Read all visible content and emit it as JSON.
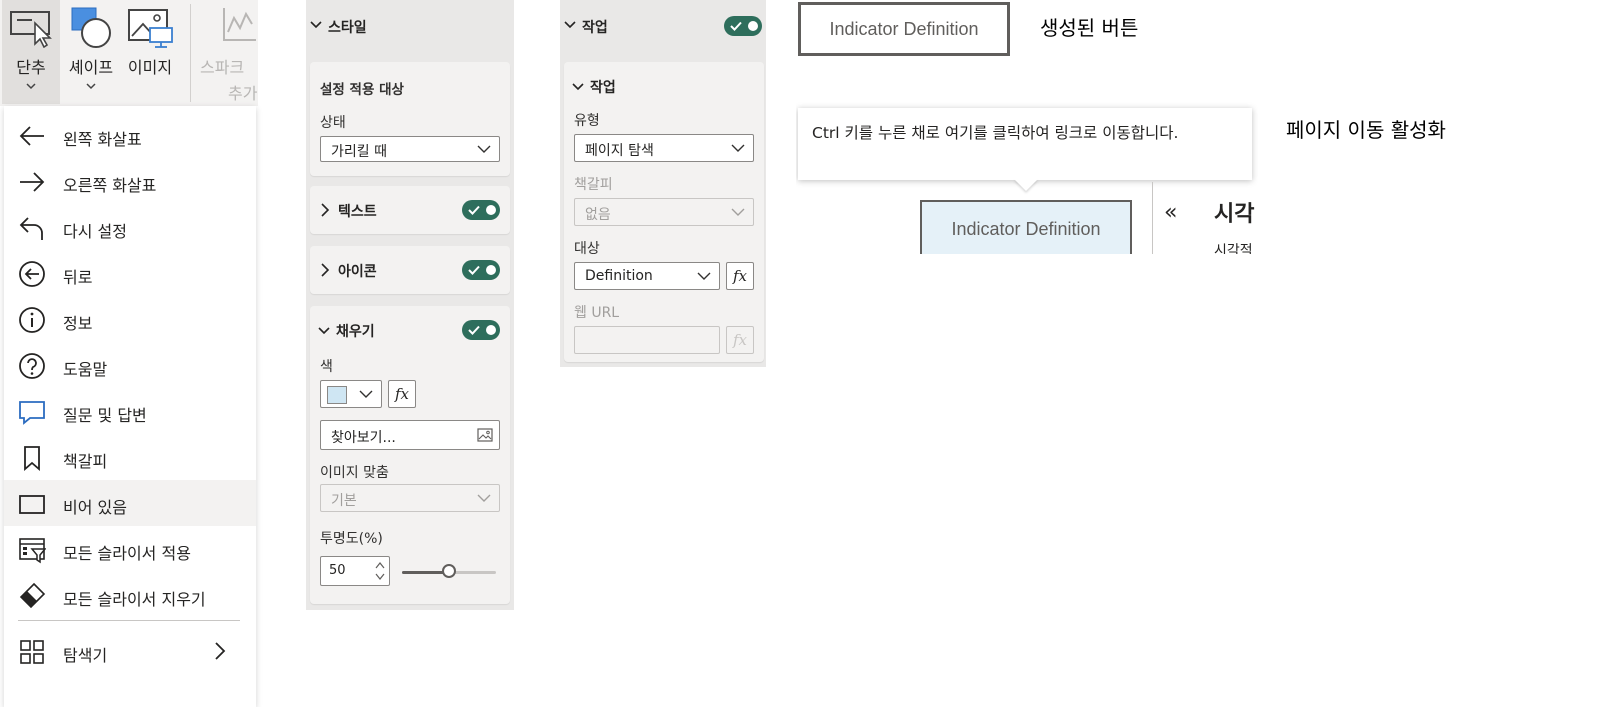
{
  "ribbon": {
    "button_label": "단추",
    "shape_label": "셰이프",
    "image_label": "이미지",
    "sparkline_label": "스파크",
    "sparkline_label2": "추가"
  },
  "menu": {
    "items": [
      {
        "label": "왼쪽 화살표",
        "icon": "arrow-left-icon"
      },
      {
        "label": "오른쪽 화살표",
        "icon": "arrow-right-icon"
      },
      {
        "label": "다시 설정",
        "icon": "reset-icon"
      },
      {
        "label": "뒤로",
        "icon": "back-circle-icon"
      },
      {
        "label": "정보",
        "icon": "info-icon"
      },
      {
        "label": "도움말",
        "icon": "help-icon"
      },
      {
        "label": "질문 및 답변",
        "icon": "qna-icon"
      },
      {
        "label": "책갈피",
        "icon": "bookmark-icon"
      },
      {
        "label": "비어 있음",
        "icon": "blank-icon"
      },
      {
        "label": "모든 슬라이서 적용",
        "icon": "apply-slicers-icon"
      },
      {
        "label": "모든 슬라이서 지우기",
        "icon": "clear-slicers-icon"
      }
    ],
    "navigator_label": "탐색기",
    "highlighted_index": 8
  },
  "style_panel": {
    "header": "스타일",
    "apply_to_label": "설정 적용 대상",
    "state_label": "상태",
    "state_value": "가리킬 때",
    "text_section": "텍스트",
    "icon_section": "아이콘",
    "fill_section": "채우기",
    "color_label": "색",
    "color_value": "#cfe6f3",
    "browse_value": "찾아보기...",
    "image_fit_label": "이미지 맞춤",
    "image_fit_value": "기본",
    "transparency_label": "투명도(%)",
    "transparency_value": "50",
    "transparency_fraction": 0.5
  },
  "action_panel": {
    "header": "작업",
    "section": "작업",
    "type_label": "유형",
    "type_value": "페이지 탐색",
    "bookmark_label": "책갈피",
    "bookmark_value": "없음",
    "destination_label": "대상",
    "destination_value": "Definition",
    "web_url_label": "웹 URL"
  },
  "demo": {
    "button_text": "Indicator Definition",
    "created_caption": "생성된 버튼",
    "tooltip_text": "Ctrl 키를 누른 채로 여기를 클릭하여 링크로 이동합니다.",
    "nav_caption": "페이지 이동 활성화",
    "button_text_2": "Indicator Definition",
    "visual_title": "시각",
    "visual_sub": "시각적"
  },
  "colors": {
    "toggle_on": "#2e6e5c",
    "ribbon_bg": "#f3f2f1",
    "panel_bg": "#e9e8e7"
  }
}
